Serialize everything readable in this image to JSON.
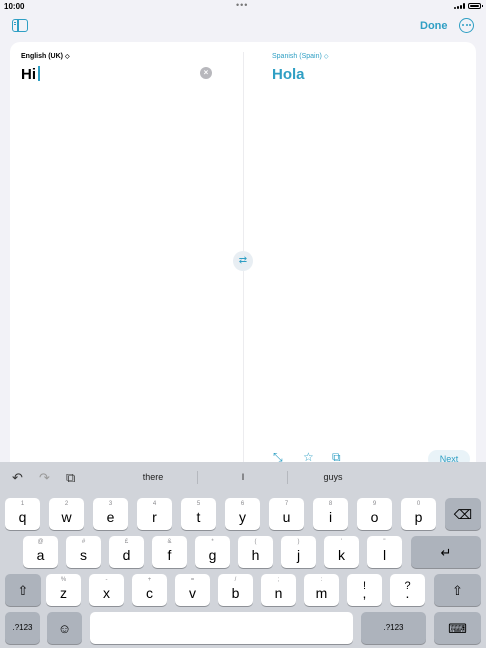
{
  "status_bar": {
    "time": "10:00",
    "dots": "•••"
  },
  "toolbar": {
    "done_label": "Done"
  },
  "translation": {
    "source_language": "English (UK)",
    "source_text": "Hi",
    "target_language": "Spanish (Spain)",
    "target_text": "Hola",
    "next_label": "Next"
  },
  "icons": {
    "lang_chevron": "◇",
    "clear": "×",
    "swap": "⇄",
    "expand": "⤡",
    "favorite": "☆",
    "copy": "⧉",
    "undo": "↶",
    "redo": "↷",
    "paste": "⧉",
    "delete": "⌫",
    "return": "↵",
    "shift": "⇧",
    "emoji": "☺",
    "hide_keyboard": "⌨"
  },
  "keyboard": {
    "suggestions": [
      "there",
      "I",
      "guys"
    ],
    "row1": [
      {
        "main": "q",
        "hint": "1"
      },
      {
        "main": "w",
        "hint": "2"
      },
      {
        "main": "e",
        "hint": "3"
      },
      {
        "main": "r",
        "hint": "4"
      },
      {
        "main": "t",
        "hint": "5"
      },
      {
        "main": "y",
        "hint": "6"
      },
      {
        "main": "u",
        "hint": "7"
      },
      {
        "main": "i",
        "hint": "8"
      },
      {
        "main": "o",
        "hint": "9"
      },
      {
        "main": "p",
        "hint": "0"
      }
    ],
    "row2": [
      {
        "main": "a",
        "hint": "@"
      },
      {
        "main": "s",
        "hint": "#"
      },
      {
        "main": "d",
        "hint": "£"
      },
      {
        "main": "f",
        "hint": "&"
      },
      {
        "main": "g",
        "hint": "*"
      },
      {
        "main": "h",
        "hint": "("
      },
      {
        "main": "j",
        "hint": ")"
      },
      {
        "main": "k",
        "hint": "'"
      },
      {
        "main": "l",
        "hint": "\""
      }
    ],
    "row3": [
      {
        "main": "z",
        "hint": "%"
      },
      {
        "main": "x",
        "hint": "-"
      },
      {
        "main": "c",
        "hint": "+"
      },
      {
        "main": "v",
        "hint": "="
      },
      {
        "main": "b",
        "hint": "/"
      },
      {
        "main": "n",
        "hint": ";"
      },
      {
        "main": "m",
        "hint": ":"
      },
      {
        "main": ",",
        "hint": "!"
      },
      {
        "main": ".",
        "hint": "?"
      }
    ],
    "numbers_label": ".?123"
  },
  "colors": {
    "accent": "#2f9fc4",
    "keyboard_bg": "#d1d4da",
    "key_bg": "#ffffff",
    "special_key_bg": "#adb3bc"
  }
}
